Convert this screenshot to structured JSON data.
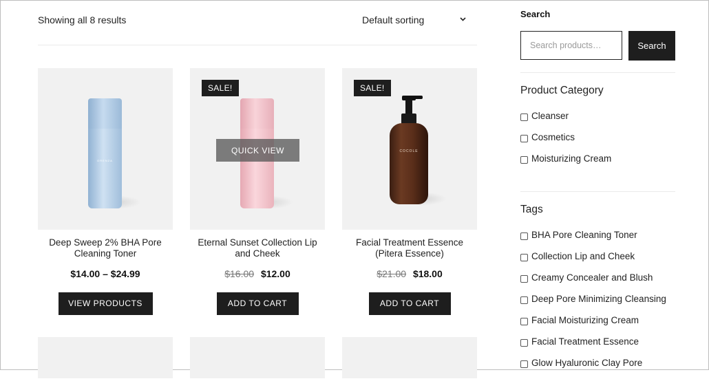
{
  "toolbar": {
    "result_count": "Showing all 8 results",
    "sorting_selected": "Default sorting"
  },
  "products": [
    {
      "title": "Deep Sweep 2% BHA Pore Cleaning Toner",
      "price": "$14.00 – $24.99",
      "old_price": "",
      "button": "VIEW PRODUCTS",
      "sale": false,
      "bottle_color": "#a7c4e0",
      "brand_text": "ORENZA"
    },
    {
      "title": "Eternal Sunset Collection Lip and Cheek",
      "price": "$12.00",
      "old_price": "$16.00",
      "button": "ADD TO CART",
      "sale": true,
      "sale_label": "SALE!",
      "quick_view": "QUICK VIEW",
      "bottle_color": "#efb9c2"
    },
    {
      "title": "Facial Treatment Essence (Pitera Essence)",
      "price": "$18.00",
      "old_price": "$21.00",
      "button": "ADD TO CART",
      "sale": true,
      "sale_label": "SALE!",
      "brand_text": "COCOLE"
    }
  ],
  "sidebar": {
    "search_heading": "Search",
    "search_placeholder": "Search products…",
    "search_button": "Search",
    "category_heading": "Product Category",
    "categories": [
      "Cleanser",
      "Cosmetics",
      "Moisturizing Cream"
    ],
    "tags_heading": "Tags",
    "tags": [
      "BHA Pore Cleaning Toner",
      "Collection Lip and Cheek",
      "Creamy Concealer and Blush",
      "Deep Pore Minimizing Cleansing",
      "Facial Moisturizing Cream",
      "Facial Treatment Essence",
      "Glow Hyaluronic Clay Pore"
    ]
  },
  "colors": {
    "button_bg": "#1e1e1e",
    "card_bg": "#f1f1f1",
    "divider": "#ebebeb"
  }
}
